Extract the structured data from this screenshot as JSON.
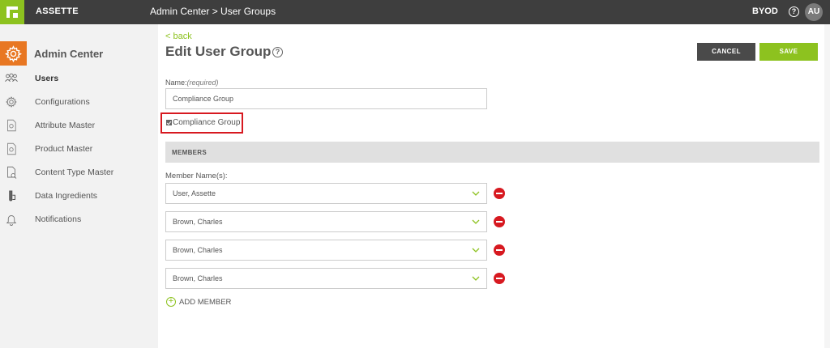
{
  "topbar": {
    "brand": "ASSETTE",
    "breadcrumb": "Admin Center > User Groups",
    "byod": "BYOD",
    "help": "?",
    "avatar": "AU"
  },
  "sidebar": {
    "header": "Admin Center",
    "items": [
      {
        "label": "Users",
        "icon": "users-icon",
        "active": true
      },
      {
        "label": "Configurations",
        "icon": "gear-icon",
        "active": false
      },
      {
        "label": "Attribute Master",
        "icon": "attribute-doc-icon",
        "active": false
      },
      {
        "label": "Product Master",
        "icon": "product-doc-icon",
        "active": false
      },
      {
        "label": "Content Type Master",
        "icon": "content-type-icon",
        "active": false
      },
      {
        "label": "Data Ingredients",
        "icon": "data-ingredients-icon",
        "active": false
      },
      {
        "label": "Notifications",
        "icon": "bell-icon",
        "active": false
      }
    ]
  },
  "main": {
    "back": "< back",
    "title": "Edit User Group",
    "title_help": "?",
    "cancel": "CANCEL",
    "save": "SAVE",
    "name_label": "Name:",
    "name_required": "(required)",
    "name_value": "Compliance Group",
    "checkbox_label": "Compliance Group",
    "members_header": "MEMBERS",
    "member_label": "Member Name(s):",
    "members": [
      "User, Assette",
      "Brown, Charles",
      "Brown, Charles",
      "Brown, Charles"
    ],
    "add_member": "ADD MEMBER"
  },
  "colors": {
    "accent_green": "#8dc21f",
    "accent_orange": "#e87722",
    "remove_red": "#d71920",
    "topbar": "#3e3e3e"
  }
}
